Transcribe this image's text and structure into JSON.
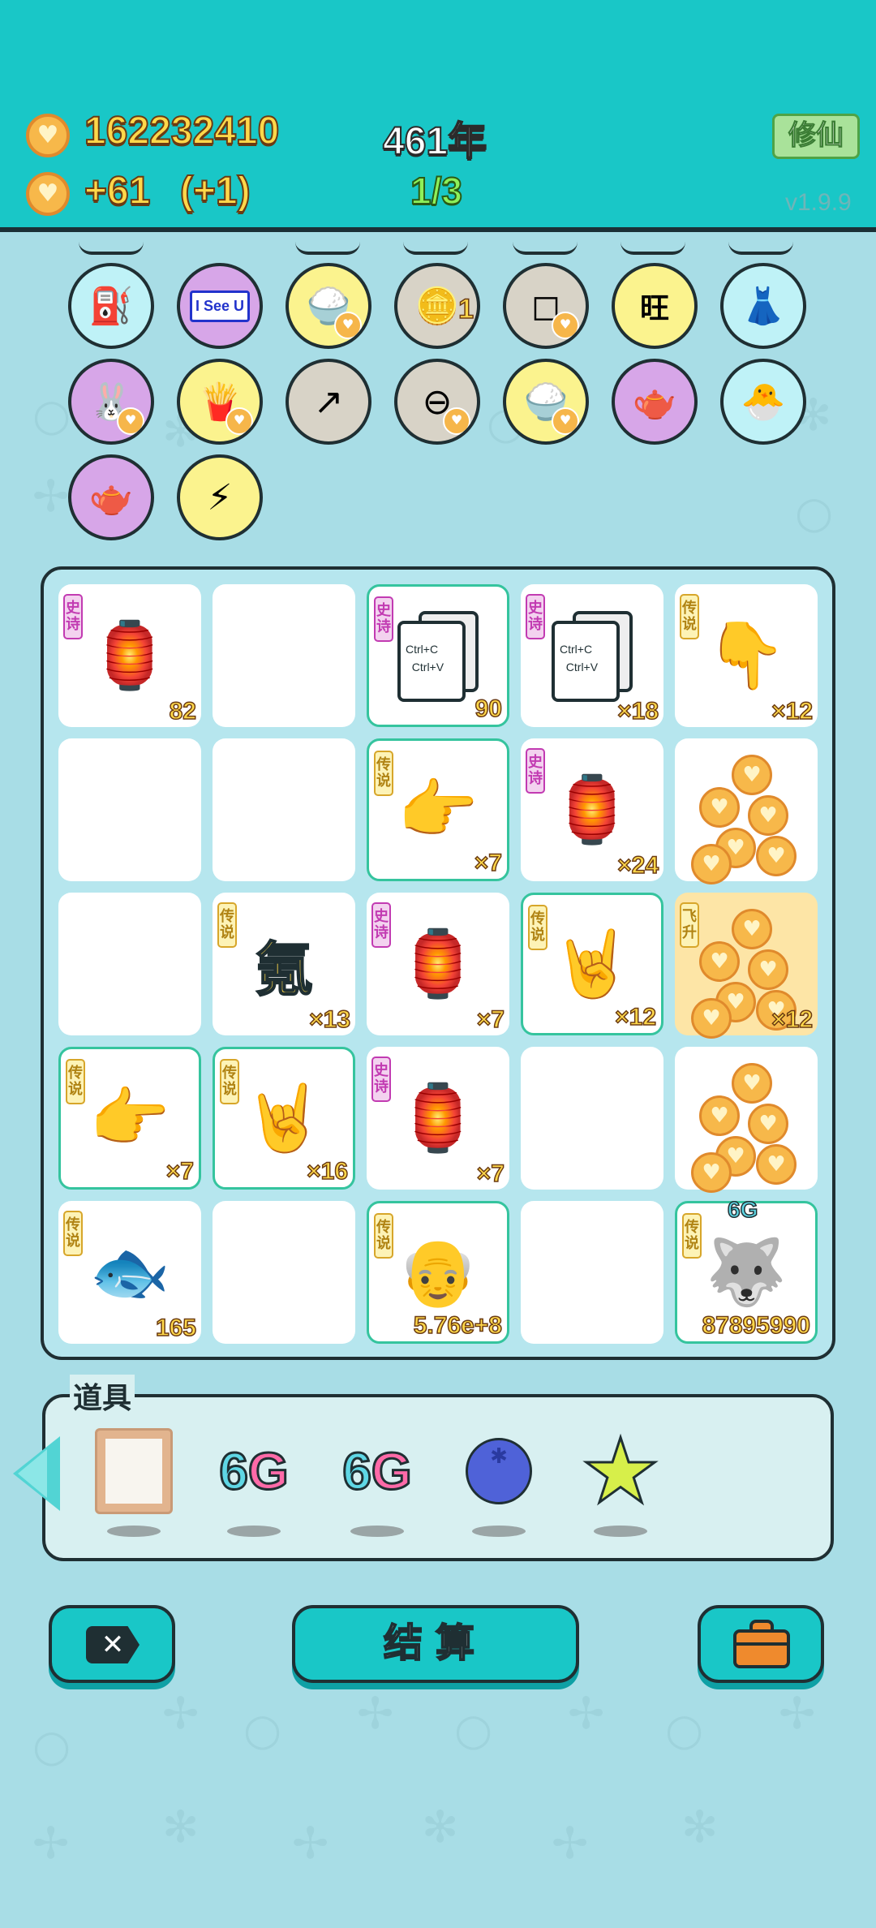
{
  "header": {
    "coins": "162232410",
    "income": "+61",
    "income_bonus": "(+1)",
    "year": "461年",
    "progress": "1/3",
    "cultivate_label": "修仙",
    "version": "v1.9.9"
  },
  "pets_row1": [
    {
      "name": "pump",
      "color": "c-cyan",
      "icon": "⛽",
      "badge": false
    },
    {
      "name": "i-see-u",
      "color": "c-purple",
      "icon": "I See U",
      "badge": false
    },
    {
      "name": "rice-bowl",
      "color": "c-yellow",
      "icon": "🍚",
      "badge": true
    },
    {
      "name": "coin-wand",
      "color": "c-gray",
      "icon": "🪙",
      "level": "1",
      "badge": false
    },
    {
      "name": "sugar-cubes",
      "color": "c-gray",
      "icon": "◻",
      "badge": true
    },
    {
      "name": "wang-tiles",
      "color": "c-yellow",
      "icon": "旺",
      "badge": false
    },
    {
      "name": "skirt",
      "color": "c-cyan",
      "icon": "👗",
      "badge": false
    }
  ],
  "pets_row2": [
    {
      "name": "rabbit",
      "color": "c-purple",
      "icon": "🐰",
      "badge": true
    },
    {
      "name": "fries",
      "color": "c-yellow",
      "icon": "🍟",
      "badge": true
    },
    {
      "name": "arrow-card",
      "color": "c-gray",
      "icon": "↗",
      "badge": false
    },
    {
      "name": "minus-sign",
      "color": "c-gray",
      "icon": "⊖",
      "badge": true
    },
    {
      "name": "rice-bowl-2",
      "color": "c-yellow",
      "icon": "🍚",
      "badge": true
    },
    {
      "name": "gravy-boat",
      "color": "c-purple",
      "icon": "🫖",
      "badge": false
    },
    {
      "name": "chick-egg",
      "color": "c-cyan",
      "icon": "🐣",
      "badge": false
    }
  ],
  "pets_row3": [
    {
      "name": "gravy-boat-2",
      "color": "c-purple",
      "icon": "🫖",
      "badge": false
    },
    {
      "name": "lightning",
      "color": "c-yellow",
      "icon": "⚡",
      "badge": false
    }
  ],
  "board": {
    "cells": [
      {
        "tag": "史诗",
        "tag_type": "epic",
        "art": "🏮",
        "count": "82",
        "hl": false
      },
      {
        "tag": "",
        "art": "",
        "count": "",
        "hl": false
      },
      {
        "tag": "史诗",
        "tag_type": "epic",
        "art": "copy",
        "count": "90",
        "hl": true
      },
      {
        "tag": "史诗",
        "tag_type": "epic",
        "art": "copy",
        "count": "×18",
        "hl": false
      },
      {
        "tag": "传说",
        "tag_type": "legend",
        "art": "👇",
        "count": "×12",
        "hl": false
      },
      {
        "tag": "",
        "art": "",
        "count": "",
        "hl": false
      },
      {
        "tag": "",
        "art": "",
        "count": "",
        "hl": false
      },
      {
        "tag": "传说",
        "tag_type": "legend",
        "art": "👉",
        "count": "×7",
        "hl": true
      },
      {
        "tag": "史诗",
        "tag_type": "epic",
        "art": "🏮",
        "count": "×24",
        "hl": false
      },
      {
        "tag": "",
        "art": "coins",
        "count": "",
        "hl": false
      },
      {
        "tag": "",
        "art": "",
        "count": "",
        "hl": false
      },
      {
        "tag": "传说",
        "tag_type": "legend",
        "art": "氪",
        "count": "×13",
        "hl": false
      },
      {
        "tag": "史诗",
        "tag_type": "epic",
        "art": "🏮",
        "count": "×7",
        "hl": false
      },
      {
        "tag": "传说",
        "tag_type": "legend",
        "art": "🤘",
        "count": "×12",
        "hl": true
      },
      {
        "tag": "飞升",
        "tag_type": "legend",
        "art": "coins",
        "count": "×12",
        "hl": false
      },
      {
        "tag": "传说",
        "tag_type": "legend",
        "art": "👉",
        "count": "×7",
        "hl": true
      },
      {
        "tag": "传说",
        "tag_type": "legend",
        "art": "🤘",
        "count": "×16",
        "hl": true
      },
      {
        "tag": "史诗",
        "tag_type": "epic",
        "art": "🏮",
        "count": "×7",
        "hl": false
      },
      {
        "tag": "",
        "art": "",
        "count": "",
        "hl": false
      },
      {
        "tag": "",
        "art": "coins",
        "count": "",
        "hl": false
      },
      {
        "tag": "传说",
        "tag_type": "legend",
        "art": "🐟",
        "count": "165",
        "hl": false
      },
      {
        "tag": "",
        "art": "",
        "count": "",
        "hl": false
      },
      {
        "tag": "传说",
        "tag_type": "legend",
        "art": "👴",
        "count": "5.76e+8",
        "hl": true
      },
      {
        "tag": "",
        "art": "",
        "count": "",
        "hl": false
      },
      {
        "tag": "传说",
        "tag_type": "legend",
        "art": "🐺",
        "count": "87895990",
        "hl": true,
        "top_label": "6G"
      }
    ]
  },
  "items": {
    "title": "道具",
    "list": [
      {
        "name": "frame",
        "icon": "frame"
      },
      {
        "name": "6g",
        "icon": "6G"
      },
      {
        "name": "6g-2",
        "icon": "6G"
      },
      {
        "name": "blueberry",
        "icon": "blueberry"
      },
      {
        "name": "star",
        "icon": "★"
      }
    ]
  },
  "buttons": {
    "cancel_icon": "✕",
    "settle_label": "结算",
    "bag_icon": "💼"
  },
  "colors": {
    "header_bg": "#19c7c7",
    "page_bg": "#a8dde6",
    "coin_text": "#ffd84a",
    "outline": "#1f2f33"
  }
}
